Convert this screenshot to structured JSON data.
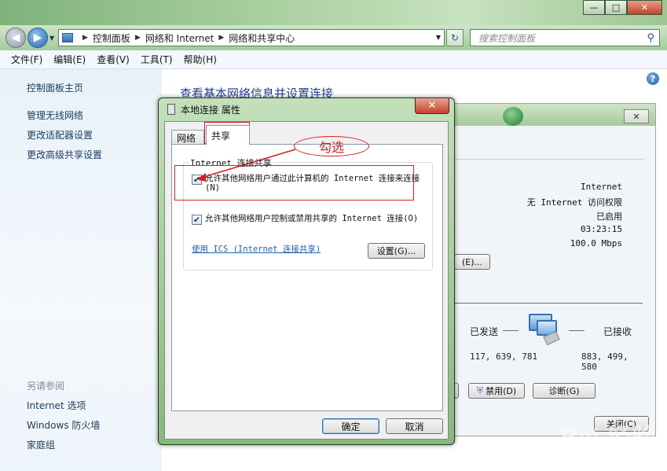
{
  "window": {
    "minimize_label": "—",
    "maximize_label": "□",
    "close_label": "✕"
  },
  "nav": {
    "breadcrumb": [
      "控制面板",
      "网络和 Internet",
      "网络和共享中心"
    ],
    "search_placeholder": "搜索控制面板",
    "refresh_label": "↻"
  },
  "menu": [
    "文件(F)",
    "编辑(E)",
    "查看(V)",
    "工具(T)",
    "帮助(H)"
  ],
  "sidebar": {
    "home": "控制面板主页",
    "links": [
      "管理无线网络",
      "更改适配器设置",
      "更改高级共享设置"
    ],
    "see_also_title": "另请参阅",
    "see_also": [
      "Internet 选项",
      "Windows 防火墙",
      "家庭组"
    ]
  },
  "content": {
    "title": "查看基本网络信息并设置连接"
  },
  "status_window": {
    "close_label": "关闭(C)",
    "values": [
      "Internet",
      "无 Internet 访问权限",
      "已启用",
      "03:23:15",
      "100.0 Mbps"
    ],
    "details_button": "(E)...",
    "sent_label": "已发送",
    "received_label": "已接收",
    "sent_bytes": "117, 639, 781",
    "received_bytes": "883, 499, 580",
    "disable_button": "禁用(D)",
    "diagnose_button": "诊断(G)"
  },
  "dialog": {
    "title": "本地连接 属性",
    "tabs": [
      "网络",
      "共享"
    ],
    "group_title": "Internet 连接共享",
    "option1": "允许其他网络用户通过此计算机的 Internet 连接来连接(N)",
    "option1_checked": true,
    "option2": "允许其他网络用户控制或禁用共享的 Internet 连接(O)",
    "option2_checked": true,
    "ics_link": "使用 ICS (Internet 连接共享)",
    "settings_button": "设置(G)...",
    "ok_button": "确定",
    "cancel_button": "取消"
  },
  "annotation": {
    "label": "勾选",
    "color": "#d42020"
  },
  "watermark": {
    "brand": "Bai 经验",
    "url": "jingyan.baidu.com"
  }
}
